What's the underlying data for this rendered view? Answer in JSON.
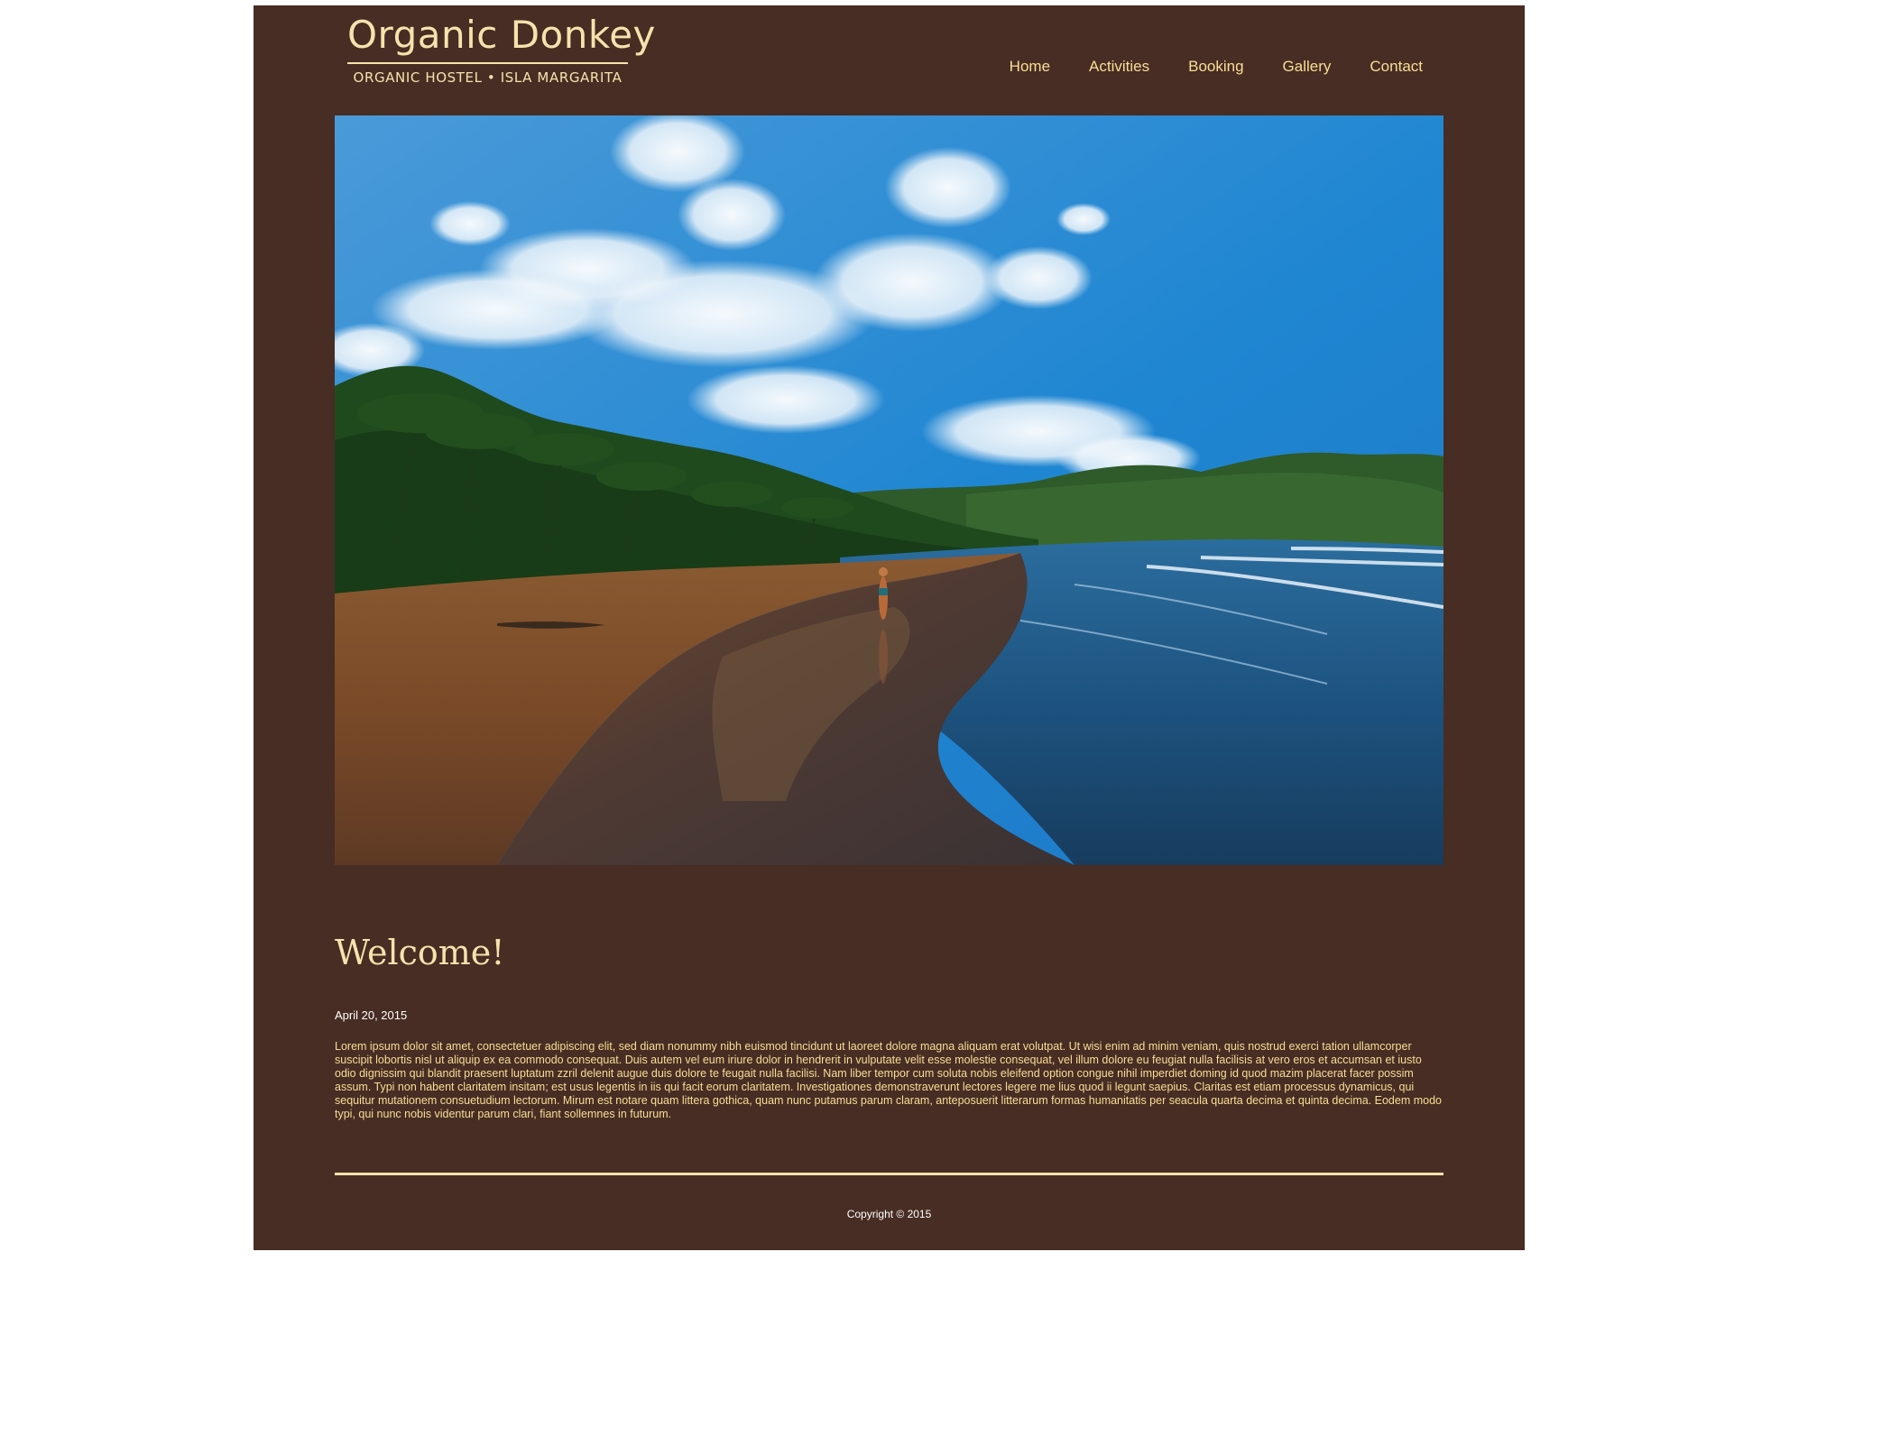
{
  "site": {
    "title": "Organic Donkey",
    "subtitle": "ORGANIC HOSTEL • ISLA MARGARITA"
  },
  "nav": {
    "items": [
      {
        "label": "Home"
      },
      {
        "label": "Activities"
      },
      {
        "label": "Booking"
      },
      {
        "label": "Gallery"
      },
      {
        "label": "Contact"
      }
    ]
  },
  "hero": {
    "description": "beach-photo"
  },
  "main": {
    "heading": "Welcome!",
    "date": "April 20, 2015",
    "body": "Lorem ipsum dolor sit amet, consectetuer adipiscing elit, sed diam nonummy nibh euismod tincidunt ut laoreet dolore magna aliquam erat volutpat. Ut wisi enim ad minim veniam, quis nostrud exerci tation ullamcorper suscipit lobortis nisl ut aliquip ex ea commodo consequat. Duis autem vel eum iriure dolor in hendrerit in vulputate velit esse molestie consequat, vel illum dolore eu feugiat nulla facilisis at vero eros et accumsan et iusto odio dignissim qui blandit praesent luptatum zzril delenit augue duis dolore te feugait nulla facilisi. Nam liber tempor cum soluta nobis eleifend option congue nihil imperdiet doming id quod mazim placerat facer possim assum. Typi non habent claritatem insitam; est usus legentis in iis qui facit eorum claritatem. Investigationes demonstraverunt lectores legere me lius quod ii legunt saepius. Claritas est etiam processus dynamicus, qui sequitur mutationem consuetudium lectorum. Mirum est notare quam littera gothica, quam nunc putamus parum claram, anteposuerit litterarum formas humanitatis per seacula quarta decima et quinta decima. Eodem modo typi, qui nunc nobis videntur parum clari, fiant sollemnes in futurum."
  },
  "footer": {
    "copyright": "Copyright © 2015"
  },
  "colors": {
    "page_bg": "#472d23",
    "accent": "#f7e2ad",
    "nav_text": "#f8de96"
  }
}
